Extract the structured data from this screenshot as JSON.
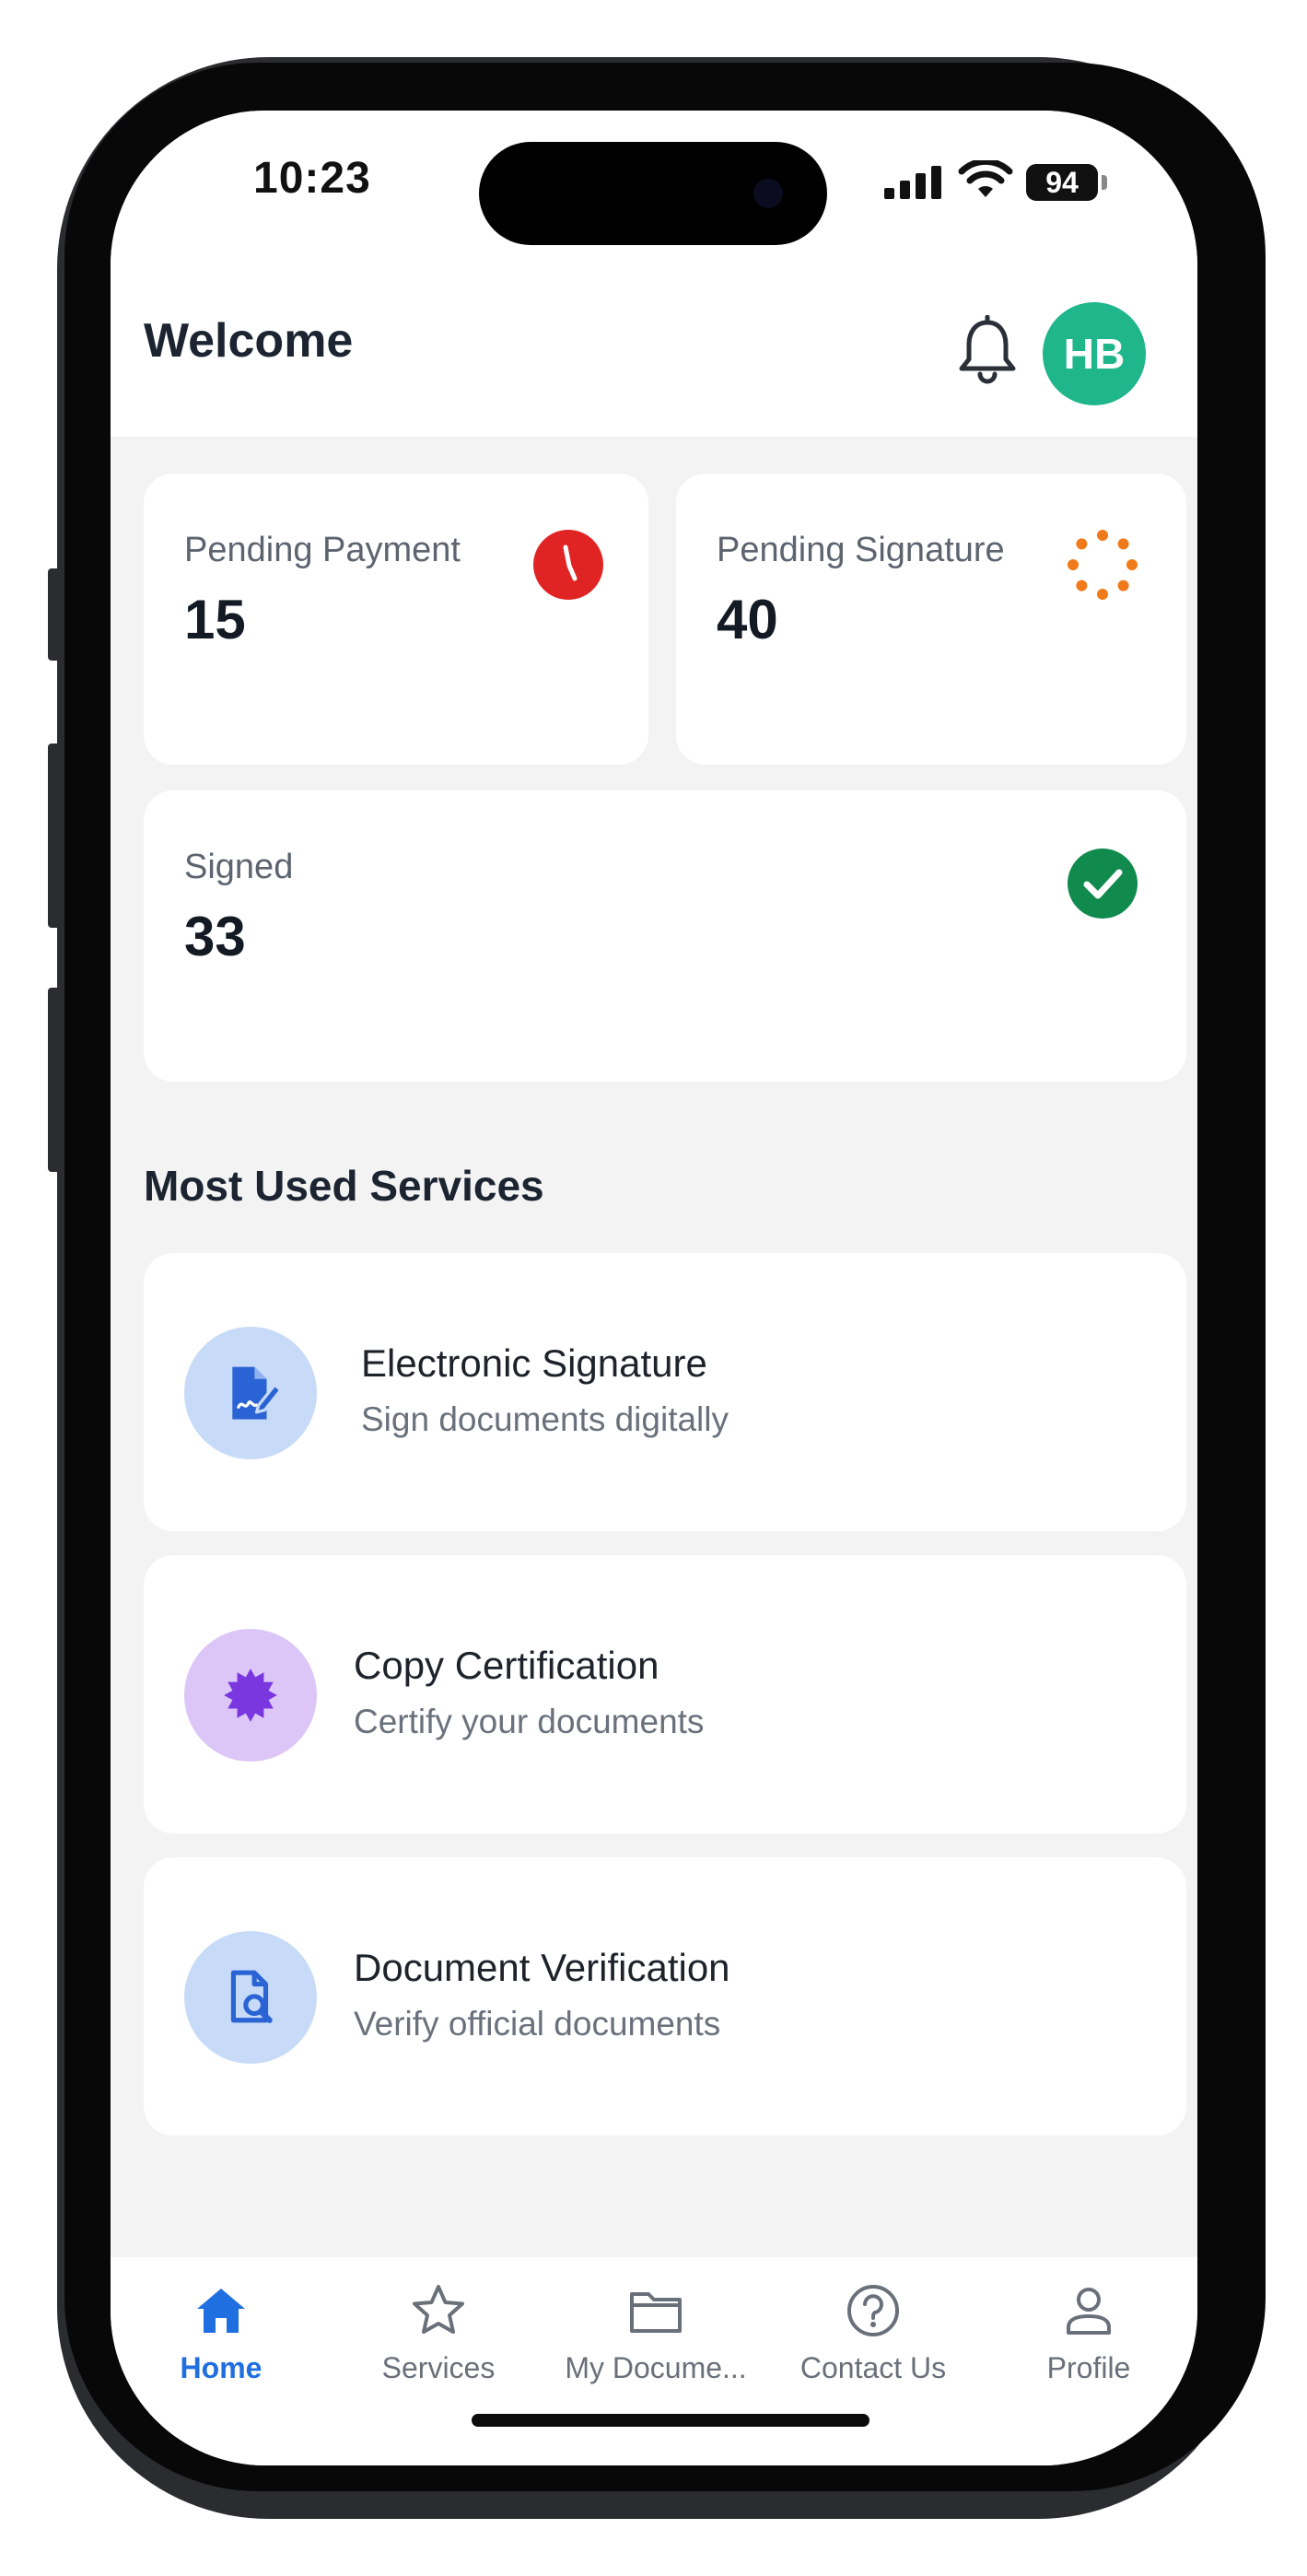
{
  "status_bar": {
    "time": "10:23",
    "battery": "94"
  },
  "header": {
    "title": "Welcome",
    "avatar_initials": "HB",
    "avatar_color": "#1fb68c"
  },
  "stats": {
    "pending_payment": {
      "label": "Pending Payment",
      "value": "15",
      "icon": "clock-icon",
      "color": "#e02424"
    },
    "pending_signature": {
      "label": "Pending Signature",
      "value": "40",
      "icon": "loading-dots-icon",
      "color": "#f07a1a"
    },
    "signed": {
      "label": "Signed",
      "value": "33",
      "icon": "check-circle-icon",
      "color": "#118a4e"
    }
  },
  "services": {
    "title": "Most Used Services",
    "items": [
      {
        "title": "Electronic Signature",
        "subtitle": "Sign documents digitally",
        "icon": "document-pen-icon",
        "bg": "#c7daf8",
        "fg": "#2a63d4"
      },
      {
        "title": "Copy Certification",
        "subtitle": "Certify your documents",
        "icon": "certificate-badge-icon",
        "bg": "#dcc6f7",
        "fg": "#7a37e0"
      },
      {
        "title": "Document Verification",
        "subtitle": "Verify official documents",
        "icon": "document-search-icon",
        "bg": "#c7daf8",
        "fg": "#2a63d4"
      }
    ]
  },
  "nav": {
    "active_color": "#1f6fe0",
    "items": [
      {
        "label": "Home",
        "icon": "home-icon"
      },
      {
        "label": "Services",
        "icon": "star-icon"
      },
      {
        "label": "My Docume...",
        "icon": "folder-icon"
      },
      {
        "label": "Contact Us",
        "icon": "help-circle-icon"
      },
      {
        "label": "Profile",
        "icon": "user-icon"
      }
    ]
  }
}
